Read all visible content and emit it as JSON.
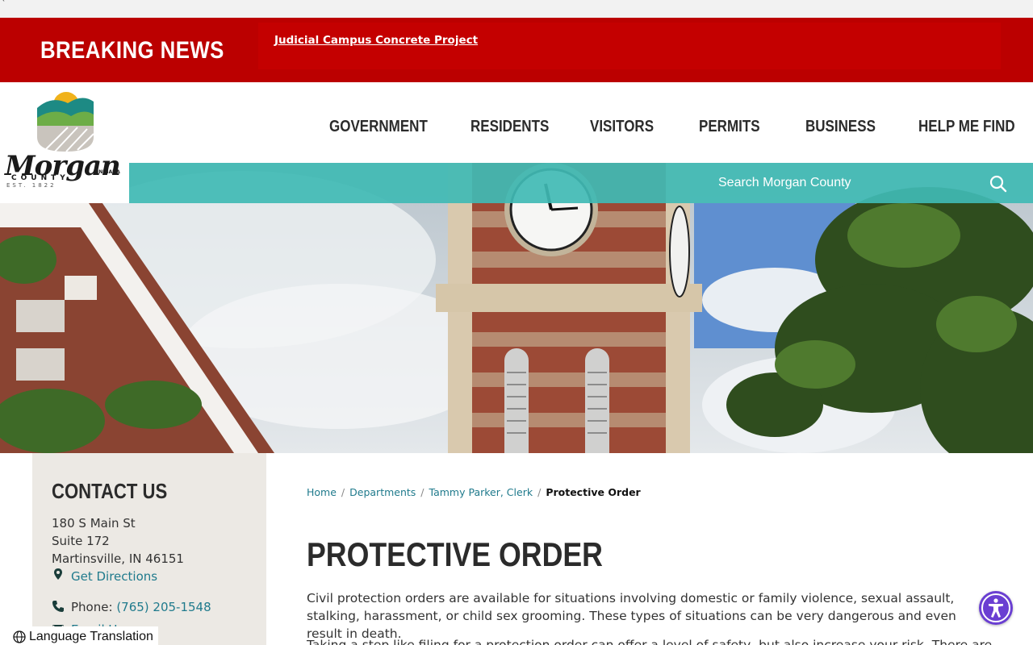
{
  "breaking_news": {
    "label": "BREAKING NEWS",
    "headline": "Judicial Campus Concrete Project"
  },
  "logo": {
    "name": "Morgan",
    "county": "COUNTY",
    "state": "INDIANA",
    "established": "EST. 1822"
  },
  "nav": {
    "items": [
      "GOVERNMENT",
      "RESIDENTS",
      "VISITORS",
      "PERMITS",
      "BUSINESS",
      "HELP ME FIND"
    ]
  },
  "search": {
    "placeholder": "Search Morgan County"
  },
  "sidebar": {
    "title": "CONTACT US",
    "address_line1": "180 S Main St",
    "address_line2": "Suite 172",
    "address_line3": "Martinsville, IN 46151",
    "directions_label": "Get Directions",
    "phone_label": "Phone:",
    "phone_number": "(765) 205-1548",
    "email_label": "Email Us"
  },
  "breadcrumb": {
    "items": [
      "Home",
      "Departments",
      "Tammy Parker, Clerk"
    ],
    "current": "Protective Order"
  },
  "page": {
    "title": "PROTECTIVE ORDER",
    "paragraph1": "Civil protection orders are available for situations involving domestic or family violence, sexual assault, stalking, harassment, or child sex grooming.  These types of situations can be very dangerous and even result in death.",
    "paragraph2_start": "Taking a step like filing for a protection order can offer a level of safety, but also increase your risk.  There are"
  },
  "language": {
    "label": "Language Translation"
  },
  "colors": {
    "breaking_red": "#bb0000",
    "search_teal": "#40bab4",
    "link_teal": "#1f7a8c",
    "sidebar_bg": "#ece9e4",
    "accessibility_purple": "#6a3fd2"
  }
}
